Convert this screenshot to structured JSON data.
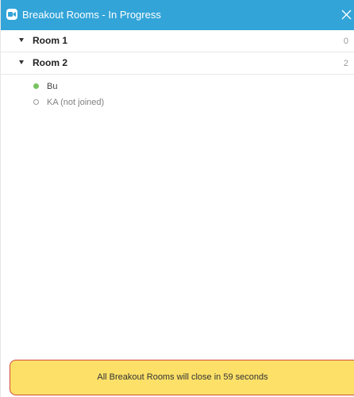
{
  "window": {
    "title": "Breakout Rooms - In Progress",
    "accent_color": "#32a4d8",
    "icons": {
      "app": "zoom-camera-icon",
      "close": "close-icon"
    }
  },
  "rooms": [
    {
      "name": "Room 1",
      "count": "0",
      "expanded_icon": "chevron-down-icon"
    },
    {
      "name": "Room 2",
      "count": "2",
      "expanded_icon": "chevron-down-icon"
    }
  ],
  "participants": [
    {
      "name": "Bu",
      "status": "joined",
      "status_color": "#79c35f"
    },
    {
      "name": "KA (not joined)",
      "status": "not-joined",
      "status_color": "#9a9a9a"
    }
  ],
  "notice": {
    "message": "All Breakout Rooms will close in 59 seconds",
    "background": "#fce068",
    "border_color": "#d44a3a"
  }
}
